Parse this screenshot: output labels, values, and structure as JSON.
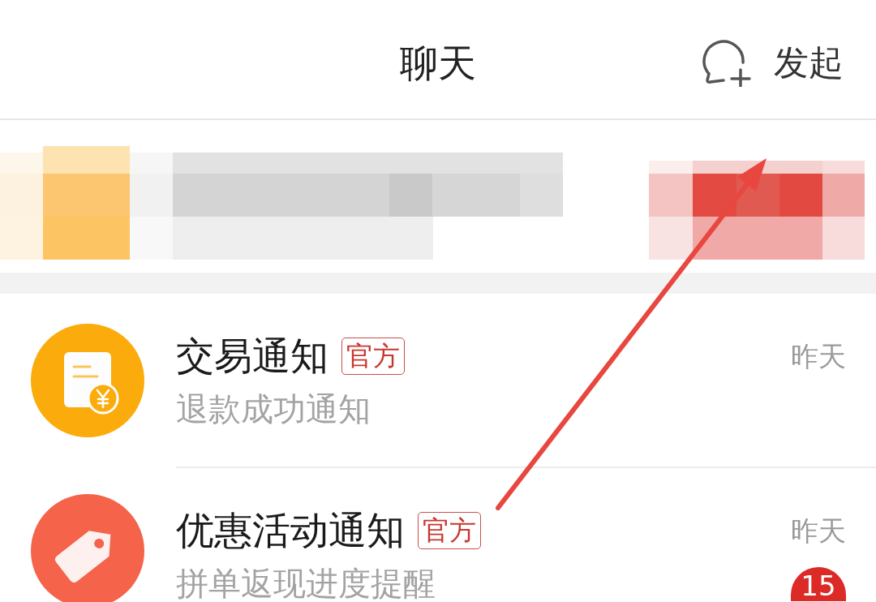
{
  "header": {
    "title": "聊天",
    "action": {
      "label": "发起"
    }
  },
  "conversations": [
    {
      "kind": "receipt",
      "title": "交易通知",
      "badge": "官方",
      "preview": "退款成功通知",
      "time": "昨天"
    },
    {
      "kind": "tag",
      "title": "优惠活动通知",
      "badge": "官方",
      "preview": "拼单返现进度提醒",
      "time": "昨天",
      "unread": "15"
    }
  ]
}
